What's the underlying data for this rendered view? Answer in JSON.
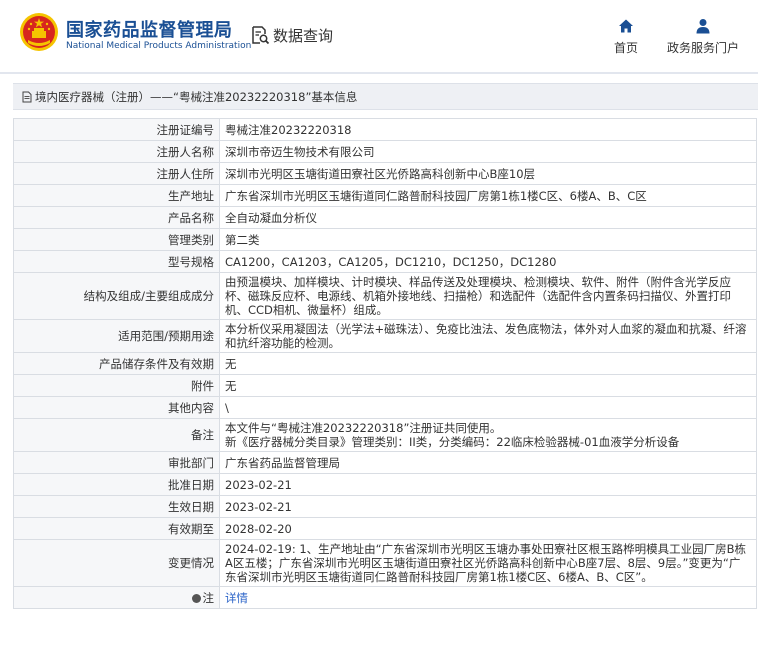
{
  "header": {
    "site_name": "国家药品监督管理局",
    "site_name_en": "National Medical Products Administration",
    "data_query": "数据查询",
    "nav": [
      {
        "label": "首页",
        "icon": "home-icon"
      },
      {
        "label": "政务服务门户",
        "icon": "user-icon"
      }
    ],
    "colors": {
      "brand": "#1a4f94",
      "emblem_red": "#d7261e",
      "emblem_gold": "#f5c400",
      "link": "#2a63c8"
    }
  },
  "breadcrumb": "境内医疗器械（注册）——“粤械注准20232220318”基本信息",
  "rows": [
    {
      "label": "注册证编号",
      "value": "粤械注准20232220318"
    },
    {
      "label": "注册人名称",
      "value": "深圳市帝迈生物技术有限公司"
    },
    {
      "label": "注册人住所",
      "value": "深圳市光明区玉塘街道田寮社区光侨路高科创新中心B座10层"
    },
    {
      "label": "生产地址",
      "value": "广东省深圳市光明区玉塘街道同仁路普耐科技园厂房第1栋1楼C区、6楼A、B、C区"
    },
    {
      "label": "产品名称",
      "value": "全自动凝血分析仪"
    },
    {
      "label": "管理类别",
      "value": "第二类"
    },
    {
      "label": "型号规格",
      "value": "CA1200，CA1203，CA1205，DC1210，DC1250，DC1280"
    },
    {
      "label": "结构及组成/主要组成成分",
      "value": "由预温模块、加样模块、计时模块、样品传送及处理模块、检测模块、软件、附件（附件含光学反应杯、磁珠反应杯、电源线、机箱外接地线、扫描枪）和选配件（选配件含内置条码扫描仪、外置打印机、CCD相机、微量杯）组成。"
    },
    {
      "label": "适用范围/预期用途",
      "value": "本分析仪采用凝固法（光学法+磁珠法）、免疫比浊法、发色底物法，体外对人血浆的凝血和抗凝、纤溶和抗纤溶功能的检测。"
    },
    {
      "label": "产品储存条件及有效期",
      "value": "无"
    },
    {
      "label": "附件",
      "value": "无"
    },
    {
      "label": "其他内容",
      "value": "\\"
    },
    {
      "label": "备注",
      "value": "本文件与“粤械注准20232220318”注册证共同使用。\n新《医疗器械分类目录》管理类别：II类，分类编码：22临床检验器械-01血液学分析设备"
    },
    {
      "label": "审批部门",
      "value": "广东省药品监督管理局"
    },
    {
      "label": "批准日期",
      "value": "2023-02-21"
    },
    {
      "label": "生效日期",
      "value": "2023-02-21"
    },
    {
      "label": "有效期至",
      "value": "2028-02-20"
    },
    {
      "label": "变更情况",
      "value": "2024-02-19: 1、生产地址由“广东省深圳市光明区玉塘办事处田寮社区根玉路桦明模具工业园厂房B栋A区五楼；广东省深圳市光明区玉塘街道田寮社区光侨路高科创新中心B座7层、8层、9层。”变更为“广东省深圳市光明区玉塘街道同仁路普耐科技园厂房第1栋1楼C区、6楼A、B、C区”。"
    }
  ],
  "note": {
    "label": "注",
    "link": "详情"
  }
}
